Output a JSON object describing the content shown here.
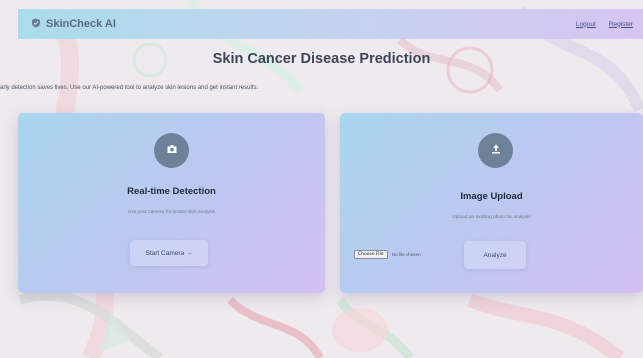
{
  "navbar": {
    "brand": "SkinCheck AI",
    "brand_icon": "shield-icon",
    "links": [
      "Logout",
      "Register"
    ]
  },
  "page": {
    "title": "Skin Cancer Disease Prediction",
    "subtitle": "arly detection saves lives. Use our AI-powered tool to analyze skin lesions and get instant results."
  },
  "cards": {
    "realtime": {
      "icon": "camera-icon",
      "title": "Real-time Detection",
      "description": "Use your camera for instant skin analysis",
      "button": "Start Camera →"
    },
    "upload": {
      "icon": "upload-icon",
      "title": "Image Upload",
      "description": "Upload an existing photo for analysis",
      "file_button": "Choose File",
      "file_status": "No file chosen",
      "button": "Analyze"
    }
  },
  "colors": {
    "navbar_gradient": [
      "#a9dcea",
      "#d6c4f2"
    ],
    "card_gradient": [
      "#a8d6ee",
      "#d3c0f3"
    ],
    "icon_circle": "#6d8298",
    "background": "#ece8ea"
  }
}
